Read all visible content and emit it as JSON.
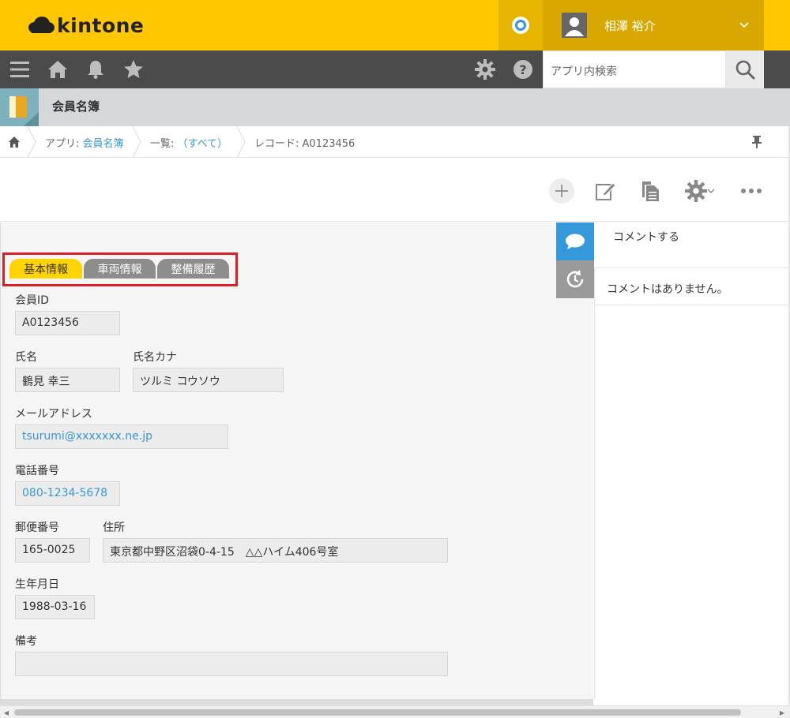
{
  "header": {
    "logo_text": "kintone",
    "user_name": "相澤 裕介",
    "brand_color": "#ffc700"
  },
  "nav": {
    "search_placeholder": "アプリ内検索"
  },
  "app": {
    "title": "会員名簿"
  },
  "breadcrumb": {
    "app_prefix": "アプリ: ",
    "app_link": "会員名簿",
    "view_prefix": "一覧: ",
    "view_link": "（すべて）",
    "record": "レコード: A0123456"
  },
  "tabs": [
    {
      "label": "基本情報",
      "active": true
    },
    {
      "label": "車両情報",
      "active": false
    },
    {
      "label": "整備履歴",
      "active": false
    }
  ],
  "fields": {
    "member_id": {
      "label": "会員ID",
      "value": "A0123456"
    },
    "name": {
      "label": "氏名",
      "value": "鶴見 幸三"
    },
    "name_kana": {
      "label": "氏名カナ",
      "value": "ツルミ コウソウ"
    },
    "email": {
      "label": "メールアドレス",
      "value": "tsurumi@xxxxxxx.ne.jp"
    },
    "phone": {
      "label": "電話番号",
      "value": "080-1234-5678"
    },
    "postal": {
      "label": "郵便番号",
      "value": "165-0025"
    },
    "address": {
      "label": "住所",
      "value": "東京都中野区沼袋0-4-15　△△ハイム406号室"
    },
    "birthdate": {
      "label": "生年月日",
      "value": "1988-03-16"
    },
    "notes": {
      "label": "備考",
      "value": ""
    }
  },
  "comments": {
    "input_placeholder": "コメントする",
    "empty_text": "コメントはありません。"
  },
  "icons": [
    "menu-icon",
    "home-icon",
    "bell-icon",
    "star-icon",
    "gear-icon",
    "help-icon",
    "search-icon",
    "add-icon",
    "edit-icon",
    "copy-icon",
    "settings-icon",
    "more-icon",
    "comment-icon",
    "history-icon",
    "pin-icon"
  ]
}
